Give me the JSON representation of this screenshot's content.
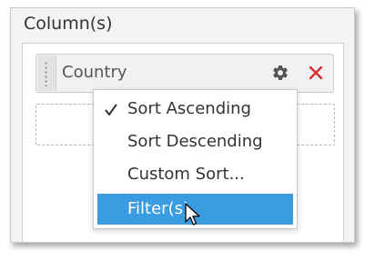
{
  "panel": {
    "title": "Column(s)"
  },
  "field": {
    "label": "Country",
    "settings_icon": "gear-icon",
    "remove_icon": "close-icon"
  },
  "menu": {
    "items": [
      {
        "label": "Sort Ascending",
        "checked": true
      },
      {
        "label": "Sort Descending",
        "checked": false
      },
      {
        "label": "Custom Sort...",
        "checked": false
      },
      {
        "label": "Filter(s)",
        "checked": false,
        "highlighted": true
      }
    ]
  },
  "colors": {
    "accent": "#3b9be0",
    "remove": "#d62b2b",
    "gear": "#555555"
  }
}
